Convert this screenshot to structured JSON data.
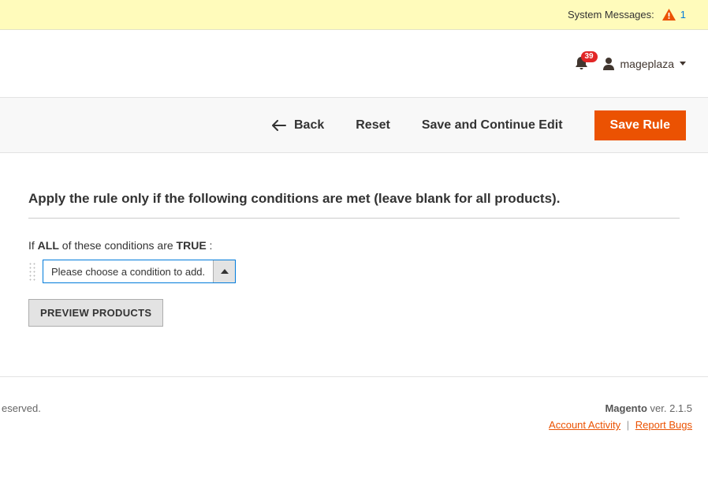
{
  "system_messages": {
    "label": "System Messages:",
    "count": "1"
  },
  "header": {
    "notification_count": "39",
    "user_name": "mageplaza"
  },
  "actions": {
    "back": "Back",
    "reset": "Reset",
    "save_continue": "Save and Continue Edit",
    "save_rule": "Save Rule"
  },
  "section": {
    "title": "Apply the rule only if the following conditions are met (leave blank for all products).",
    "sentence_prefix": "If ",
    "sentence_all": "ALL",
    "sentence_mid": "  of these conditions are ",
    "sentence_true": "TRUE",
    "sentence_suffix": " :",
    "condition_placeholder": "Please choose a condition to add.",
    "preview_label": "PREVIEW PRODUCTS"
  },
  "footer": {
    "left": "eserved.",
    "brand": "Magento",
    "version": " ver. 2.1.5",
    "account_activity": "Account Activity",
    "report_bugs": "Report Bugs"
  }
}
